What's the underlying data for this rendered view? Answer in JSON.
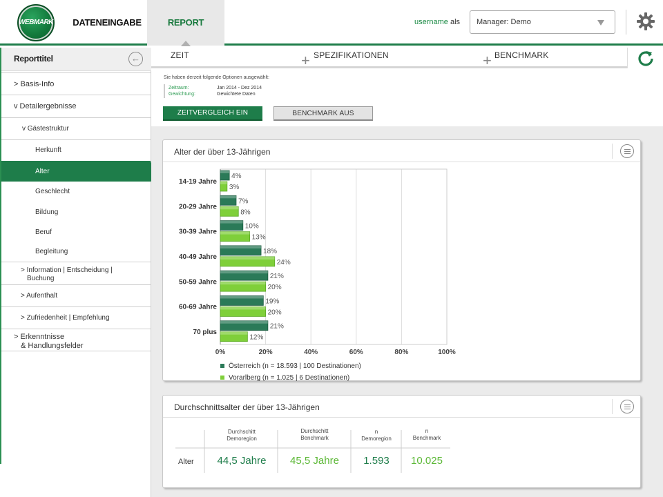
{
  "header": {
    "logo_text": "WEBMARK",
    "nav_tabs": [
      {
        "label": "DATENEINGABE"
      },
      {
        "label": "REPORT"
      }
    ],
    "username": "username",
    "als": "als",
    "role_select": "Manager: Demo"
  },
  "colors": {
    "primary_green": "#1e7d4a",
    "series_oesterreich": "#2b7a58",
    "series_vorarlberg": "#7fcf3a",
    "accent_light_green": "#5cb836"
  },
  "sidebar": {
    "title": "Reporttitel",
    "items": [
      {
        "label": "> Basis-Info"
      },
      {
        "label": "v Detailergebnisse"
      },
      {
        "label": "v Gästestruktur"
      },
      {
        "label": "Herkunft"
      },
      {
        "label": "Alter"
      },
      {
        "label": "Geschlecht"
      },
      {
        "label": "Bildung"
      },
      {
        "label": "Beruf"
      },
      {
        "label": "Begleitung"
      },
      {
        "label_line1": "> Information | Entscheidung |",
        "label_line2": "Buchung"
      },
      {
        "label": "> Aufenthalt"
      },
      {
        "label": "> Zufriedenheit | Empfehlung"
      },
      {
        "label_line1": "> Erkenntnisse",
        "label_line2": "& Handlungsfelder"
      }
    ]
  },
  "subtabs": [
    {
      "label": "ZEIT"
    },
    {
      "label": "SPEZIFIKATIONEN"
    },
    {
      "label": "BENCHMARK"
    }
  ],
  "options": {
    "intro": "Sie haben derzeit folgende Optionen ausgewählt:",
    "rows": [
      {
        "key": "Zeitraum:",
        "value": "Jan 2014 - Dez 2014"
      },
      {
        "key": "Gewichtung:",
        "value": "Gewichtete Daten"
      }
    ],
    "btn_zeitvergleich": "ZEITVERGLEICH EIN",
    "btn_benchmark": "BENCHMARK AUS"
  },
  "age_card": {
    "title": "Alter der über 13-Jährigen"
  },
  "chart_data": {
    "type": "bar",
    "orientation": "horizontal",
    "categories": [
      "14-19 Jahre",
      "20-29 Jahre",
      "30-39 Jahre",
      "40-49 Jahre",
      "50-59 Jahre",
      "60-69 Jahre",
      "70 plus"
    ],
    "series": [
      {
        "name": "Österreich (n = 18.593 | 100 Destinationen)",
        "values": [
          4,
          7,
          10,
          18,
          21,
          19,
          21
        ],
        "labels": [
          "4%",
          "7%",
          "10%",
          "18%",
          "21%",
          "19%",
          "21%"
        ]
      },
      {
        "name": "Vorarlberg (n = 1.025 | 6 Destinationen)",
        "values": [
          3,
          8,
          13,
          24,
          20,
          20,
          12
        ],
        "labels": [
          "3%",
          "8%",
          "13%",
          "24%",
          "20%",
          "20%",
          "12%"
        ]
      }
    ],
    "xlim": [
      0,
      100
    ],
    "xticks": [
      "0%",
      "20%",
      "40%",
      "60%",
      "80%",
      "100%"
    ],
    "legend_position": "bottom-left",
    "grid": true
  },
  "avg_card": {
    "title": "Durchschnittsalter der über 13-Jährigen",
    "columns": [
      {
        "line1": "Durchschitt",
        "line2": "Demoregion"
      },
      {
        "line1": "Durchschitt",
        "line2": "Benchmark"
      },
      {
        "line1": "n",
        "line2": "Demoregion"
      },
      {
        "line1": "n",
        "line2": "Benchmark"
      }
    ],
    "row_label": "Alter",
    "values": [
      "44,5 Jahre",
      "45,5 Jahre",
      "1.593",
      "10.025"
    ]
  }
}
